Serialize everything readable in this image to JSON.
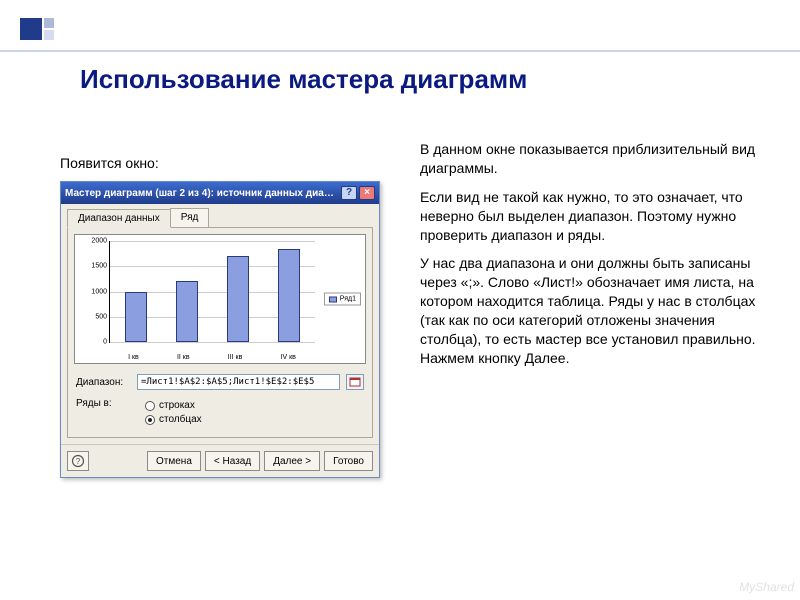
{
  "page_title": "Использование мастера диаграмм",
  "intro": "Появится окно:",
  "description": {
    "p1": "В данном окне показывается приблизительный вид диаграммы.",
    "p2": "Если вид не  такой как нужно, то это означает, что неверно был выделен диапазон. Поэтому нужно проверить диапазон и ряды.",
    "p3": "У нас два диапазона и они должны быть записаны через «;». Слово «Лист!» обозначает имя листа, на котором находится таблица. Ряды у нас в столбцах (так как по оси категорий отложены значения столбца), то есть мастер все установил правильно. Нажмем кнопку Далее."
  },
  "wizard": {
    "title": "Мастер диаграмм (шаг 2 из 4): источник данных диа…",
    "tabs": {
      "data_range": "Диапазон данных",
      "series": "Ряд"
    },
    "range_label": "Диапазон:",
    "range_value": "=Лист1!$A$2:$A$5;Лист1!$E$2:$E$5",
    "rows_in_label": "Ряды в:",
    "rows_in": {
      "rows": "строках",
      "cols": "столбцах",
      "selected": "cols"
    },
    "buttons": {
      "cancel": "Отмена",
      "back": "< Назад",
      "next": "Далее >",
      "finish": "Готово"
    }
  },
  "chart_data": {
    "type": "bar",
    "categories": [
      "I кв",
      "II кв",
      "III кв",
      "IV кв"
    ],
    "values": [
      1000,
      1200,
      1700,
      1850
    ],
    "series": [
      {
        "name": "Ряд1",
        "values": [
          1000,
          1200,
          1700,
          1850
        ]
      }
    ],
    "legend_label": "Ряд1",
    "ylim": [
      0,
      2000
    ],
    "yticks": [
      0,
      500,
      1000,
      1500,
      2000
    ],
    "xlabel": "",
    "ylabel": "",
    "title": ""
  },
  "watermark": "MyShared"
}
